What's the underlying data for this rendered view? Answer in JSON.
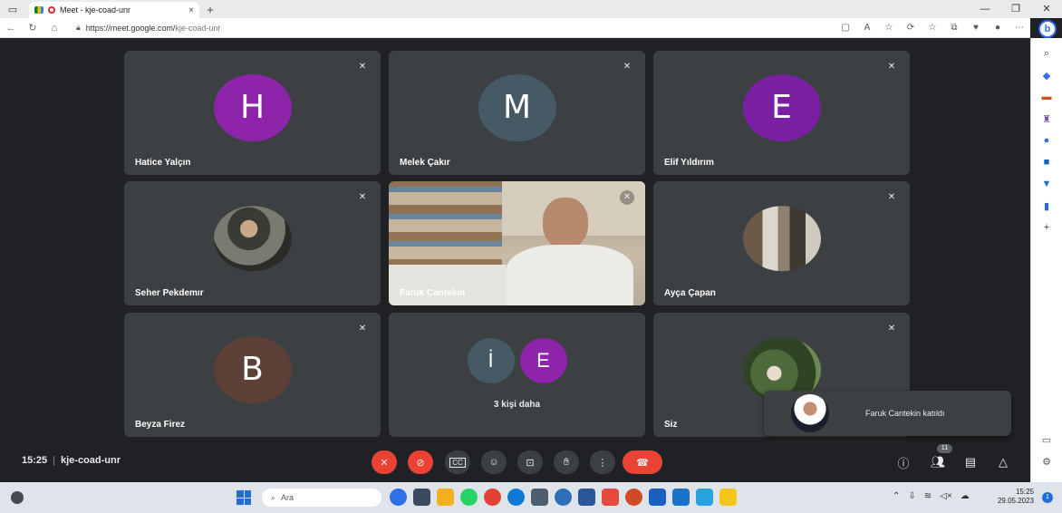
{
  "browser": {
    "tab_title": "Meet - kje-coad-unr",
    "tab_close": "×",
    "new_tab": "+",
    "url_host": "https://meet.google.com/",
    "url_path": "kje-coad-unr",
    "bing_label": "b"
  },
  "participants": [
    {
      "name": "Hatice Yalçın",
      "initial": "H",
      "color": "#8e24aa"
    },
    {
      "name": "Melek Çakır",
      "initial": "M",
      "color": "#455a64"
    },
    {
      "name": "Elif Yıldırım",
      "initial": "E",
      "color": "#7b1fa2"
    },
    {
      "name": "Seher Pekdemır",
      "initial": "",
      "color": "#000000"
    },
    {
      "name": "Faruk Cantekin",
      "initial": "",
      "color": "#000000"
    },
    {
      "name": "Ayça Çapan",
      "initial": "",
      "color": "#000000"
    },
    {
      "name": "Beyza Firez",
      "initial": "B",
      "color": "#5d4037"
    },
    {
      "name": "Siz",
      "initial": "",
      "color": "#000000"
    }
  ],
  "more_tile": {
    "avatars": [
      {
        "initial": "İ",
        "color": "#455a64"
      },
      {
        "initial": "E",
        "color": "#8e24aa"
      }
    ],
    "label": "3 kişi daha"
  },
  "toast": {
    "text": "Faruk Cantekin katıldı"
  },
  "controls": {
    "time": "15:25",
    "meeting_code": "kje-coad-unr",
    "participant_count": "11"
  },
  "taskbar": {
    "search_label": "Ara",
    "time": "15:25",
    "date": "29.05.2023",
    "notification_count": "1"
  }
}
